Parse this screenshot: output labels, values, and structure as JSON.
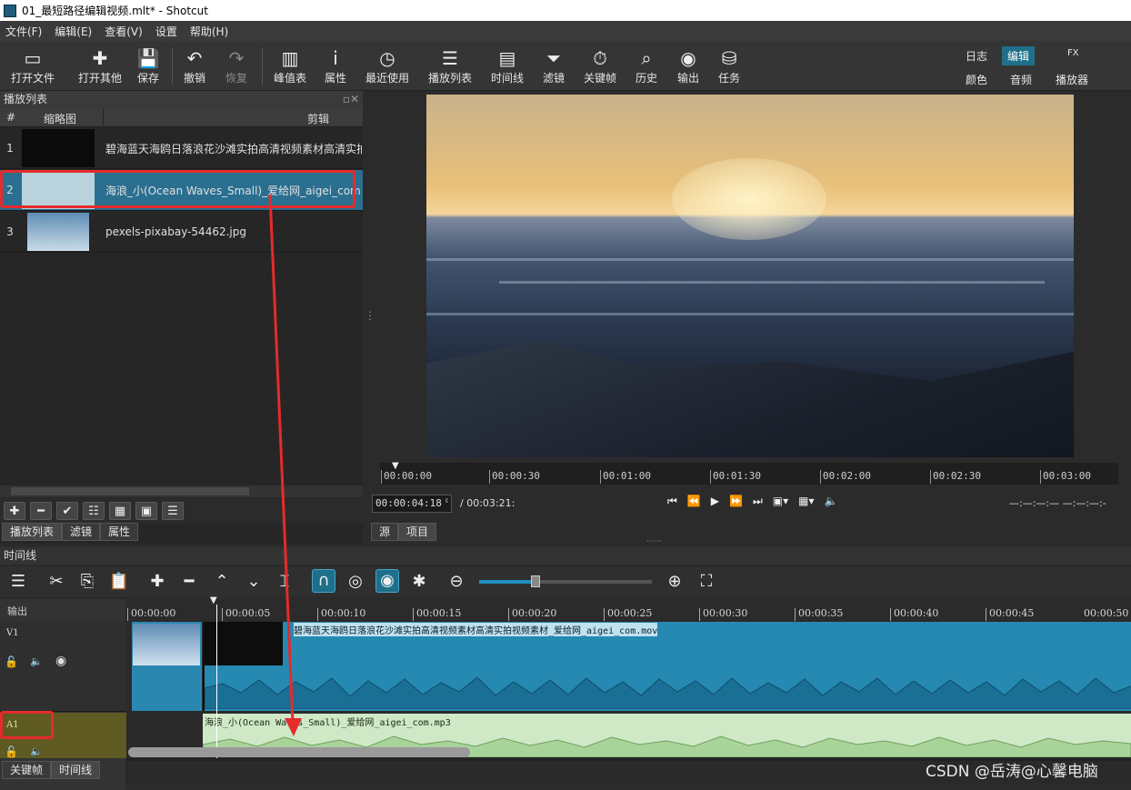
{
  "window": {
    "title": "01_最短路径编辑视频.mlt* - Shotcut"
  },
  "menu": [
    "文件(F)",
    "编辑(E)",
    "查看(V)",
    "设置",
    "帮助(H)"
  ],
  "toolbar": [
    {
      "label": "打开文件",
      "icon": "open-file-icon",
      "glyph": "▭"
    },
    {
      "label": "打开其他",
      "icon": "open-other-icon",
      "glyph": "✚"
    },
    {
      "label": "保存",
      "icon": "save-icon",
      "glyph": "💾"
    },
    {
      "label": "撤销",
      "icon": "undo-icon",
      "glyph": "↶"
    },
    {
      "label": "恢复",
      "icon": "redo-icon",
      "glyph": "↷"
    },
    {
      "label": "峰值表",
      "icon": "peak-meter-icon",
      "glyph": "▥"
    },
    {
      "label": "属性",
      "icon": "info-icon",
      "glyph": "i"
    },
    {
      "label": "最近使用",
      "icon": "clock-icon",
      "glyph": "◷"
    },
    {
      "label": "播放列表",
      "icon": "list-icon",
      "glyph": "☰"
    },
    {
      "label": "时间线",
      "icon": "timeline-icon",
      "glyph": "▤"
    },
    {
      "label": "滤镜",
      "icon": "filter-icon",
      "glyph": "⏷"
    },
    {
      "label": "关键帧",
      "icon": "stopwatch-icon",
      "glyph": "⏱"
    },
    {
      "label": "历史",
      "icon": "history-icon",
      "glyph": "⌕"
    },
    {
      "label": "输出",
      "icon": "disc-icon",
      "glyph": "◉"
    },
    {
      "label": "任务",
      "icon": "database-icon",
      "glyph": "⛁"
    }
  ],
  "layouts": {
    "row1": [
      "日志",
      "编辑",
      "FX"
    ],
    "row2": [
      "颜色",
      "音频",
      "播放器"
    ]
  },
  "playlist": {
    "title": "播放列表",
    "columns": [
      "#",
      "缩略图",
      "剪辑"
    ],
    "rows": [
      {
        "num": "1",
        "name": "碧海蓝天海鸥日落浪花沙滩实拍高清视频素材高清实拍"
      },
      {
        "num": "2",
        "name": "海浪_小(Ocean Waves_Small)_爱给网_aigei_com.m"
      },
      {
        "num": "3",
        "name": "pexels-pixabay-54462.jpg"
      }
    ],
    "tabs": [
      "播放列表",
      "滤镜",
      "属性"
    ]
  },
  "viewer": {
    "ruler": [
      "00:00:00",
      "00:00:30",
      "00:01:00",
      "00:01:30",
      "00:02:00",
      "00:02:30",
      "00:03:00"
    ],
    "timecode": "00:00:04:18",
    "duration": "/ 00:03:21:",
    "inout": "—:—:—:— —:—:—:-",
    "tabs": [
      "源",
      "项目"
    ]
  },
  "timeline": {
    "title": "时间线",
    "output": "输出",
    "ruler": [
      "00:00:00",
      "00:00:05",
      "00:00:10",
      "00:00:15",
      "00:00:20",
      "00:00:25",
      "00:00:30",
      "00:00:35",
      "00:00:40",
      "00:00:45",
      "00:00:50"
    ],
    "tracks": [
      "V1",
      "A1"
    ],
    "v1_clip": "碧海蓝天海鸥日落浪花沙滩实拍高清视频素材高清实拍视频素材_爱给网_aigei_com.mov",
    "a1_clip": "海浪_小(Ocean Waves_Small)_爱给网_aigei_com.mp3",
    "zoom": 0.6
  },
  "bottom_tabs": [
    "关键帧",
    "时间线"
  ],
  "watermark": "CSDN @岳涛@心馨电脑",
  "colors": {
    "accent": "#1f6f8b",
    "highlight": "#e52b2b",
    "video_clip": "#2589b2",
    "audio_clip": "#cfe8c6"
  }
}
